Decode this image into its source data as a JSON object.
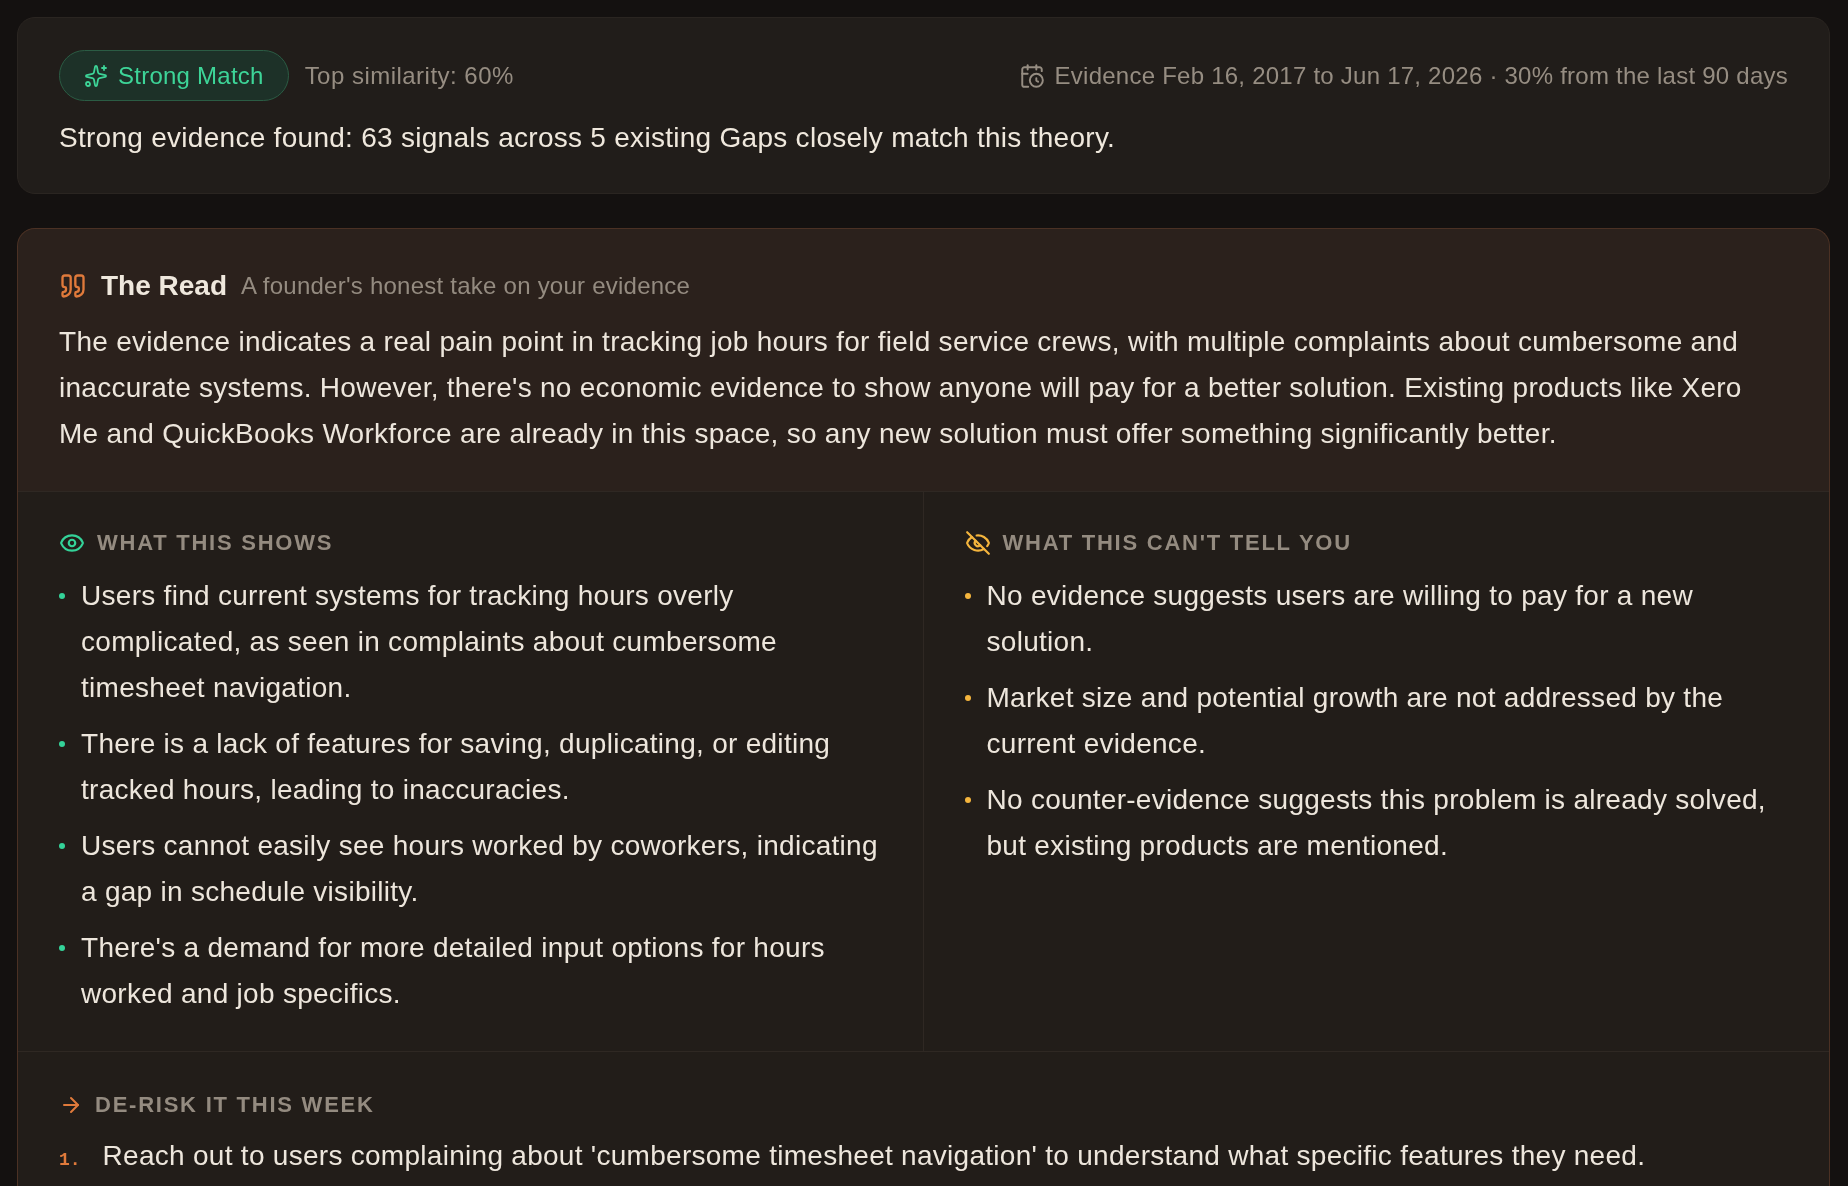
{
  "match_card": {
    "badge": {
      "label": "Strong Match"
    },
    "similarity": "Top similarity: 60%",
    "evidence_range": "Evidence Feb 16, 2017 to Jun 17, 2026 · 30% from the last 90 days",
    "summary": "Strong evidence found: 63 signals across 5 existing Gaps closely match this theory."
  },
  "the_read": {
    "title": "The Read",
    "subtitle": "A founder's honest take on your evidence",
    "body": "The evidence indicates a real pain point in tracking job hours for field service crews, with multiple complaints about cumbersome and inaccurate systems. However, there's no economic evidence to show anyone will pay for a better solution. Existing products like Xero Me and QuickBooks Workforce are already in this space, so any new solution must offer something significantly better.",
    "columns": [
      {
        "kind": "shows",
        "heading": "WHAT THIS SHOWS",
        "items": [
          "Users find current systems for tracking hours overly complicated, as seen in complaints about cumbersome timesheet navigation.",
          "There is a lack of features for saving, duplicating, or editing tracked hours, leading to inaccuracies.",
          "Users cannot easily see hours worked by coworkers, indicating a gap in schedule visibility.",
          "There's a demand for more detailed input options for hours worked and job specifics."
        ]
      },
      {
        "kind": "limits",
        "heading": "WHAT THIS CAN'T TELL YOU",
        "items": [
          "No evidence suggests users are willing to pay for a new solution.",
          "Market size and potential growth are not addressed by the current evidence.",
          "No counter-evidence suggests this problem is already solved, but existing products are mentioned."
        ]
      }
    ],
    "derisk": {
      "heading": "DE-RISK IT THIS WEEK",
      "steps": [
        {
          "number": "1.",
          "text": "Reach out to users complaining about 'cumbersome timesheet navigation' to understand what specific features they need."
        }
      ]
    }
  }
}
